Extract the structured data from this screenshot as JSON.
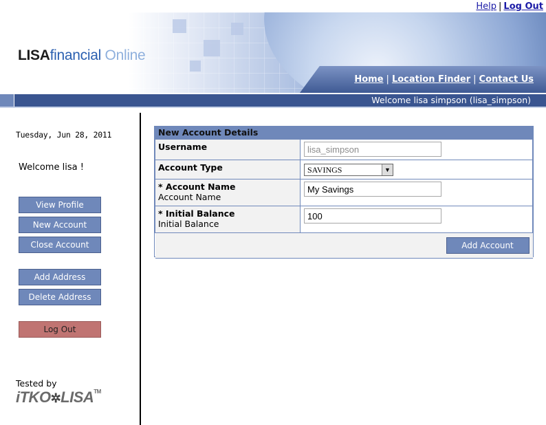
{
  "top_links": {
    "help": "Help",
    "separator": "|",
    "logout": "Log Out"
  },
  "brand": {
    "part1": "LISA",
    "part2": "financial",
    "part3": " Online"
  },
  "nav": {
    "home": "Home",
    "location_finder": "Location Finder",
    "contact_us": "Contact Us",
    "separator": "|"
  },
  "welcome_bar": "Welcome lisa simpson (lisa_simpson)",
  "sidebar": {
    "date": "Tuesday, Jun 28, 2011",
    "welcome": "Welcome lisa !",
    "buttons": {
      "view_profile": "View Profile",
      "new_account": "New Account",
      "close_account": "Close Account",
      "add_address": "Add Address",
      "delete_address": "Delete Address",
      "log_out": "Log Out"
    },
    "tested_by": "Tested by",
    "footer_logo": {
      "part1": "iTKO",
      "part2": "LISA",
      "tm": "TM"
    }
  },
  "form": {
    "title": "New Account Details",
    "username": {
      "label": "Username",
      "value": "lisa_simpson"
    },
    "account_type": {
      "label": "Account Type",
      "value": "SAVINGS"
    },
    "account_name": {
      "label": "* Account Name",
      "sublabel": "Account Name",
      "value": "My Savings"
    },
    "initial_balance": {
      "label": "* Initial Balance",
      "sublabel": "Initial Balance",
      "value": "100"
    },
    "submit": "Add Account"
  },
  "colors": {
    "accent": "#6f88ba",
    "dark_bar": "#3a5590",
    "logout_button": "#c07472"
  },
  "icons": {
    "select_arrow": "chevron-down-icon",
    "logo_mark": "gear-icon"
  }
}
